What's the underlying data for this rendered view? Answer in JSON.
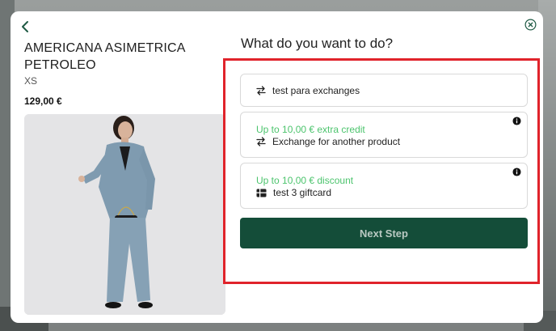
{
  "modal": {
    "back_icon": "chevron-left-icon",
    "close_icon": "close-circle-icon"
  },
  "product": {
    "title": "AMERICANA ASIMETRICA PETROLEO",
    "size": "XS",
    "price": "129,00 €"
  },
  "panel": {
    "heading": "What do you want to do?",
    "options": [
      {
        "label": "test para exchanges",
        "icon": "exchange-arrows-icon"
      },
      {
        "credit": "Up to 10,00 € extra credit",
        "label": "Exchange for another product",
        "icon": "exchange-arrows-icon"
      },
      {
        "credit": "Up to 10,00 € discount",
        "label": "test 3 giftcard",
        "icon": "giftcard-icon"
      }
    ],
    "next_label": "Next Step"
  },
  "colors": {
    "accent_green": "#144d39",
    "credit_green": "#4cc46d",
    "highlight_red": "#e0232b"
  }
}
